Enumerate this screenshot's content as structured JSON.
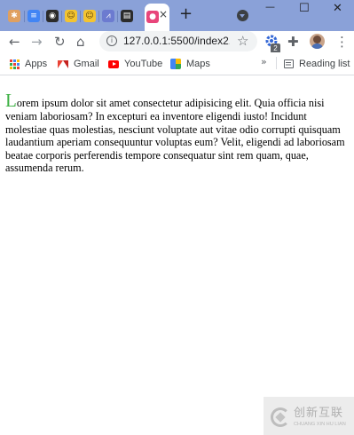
{
  "tabstrip": {
    "tabs": [
      {
        "icon": "puzzle-favicon",
        "color": "#e0a060",
        "glyph": "✱"
      },
      {
        "icon": "docs-favicon",
        "color": "#4285f4",
        "glyph": "≡"
      },
      {
        "icon": "circle-favicon",
        "color": "#2b2b2b",
        "glyph": "◉"
      },
      {
        "icon": "emoji-favicon",
        "color": "#f4c430",
        "glyph": "☺"
      },
      {
        "icon": "emoji-favicon",
        "color": "#f4c430",
        "glyph": "☺"
      },
      {
        "icon": "chart-favicon",
        "color": "#6c7bd0",
        "glyph": "⩘"
      },
      {
        "icon": "app-favicon",
        "color": "#2b2b2b",
        "glyph": "▤"
      }
    ],
    "active_tab": {
      "icon": "pink-favicon",
      "color": "#e8457a",
      "glyph": "●",
      "close_glyph": "×"
    },
    "new_tab_glyph": "+",
    "window": {
      "minimize_glyph": "—",
      "maximize_glyph": "☐",
      "close_glyph": "✕"
    }
  },
  "toolbar": {
    "back_glyph": "←",
    "forward_glyph": "→",
    "reload_glyph": "↻",
    "home_glyph": "⌂",
    "info_glyph": "i",
    "url": "127.0.0.1:5500/index2...",
    "star_glyph": "☆",
    "extension_badge": "2",
    "extensions_glyph": "✚",
    "menu_glyph": "⋮"
  },
  "bookmarks": {
    "items": [
      {
        "label": "Apps",
        "icon": "apps-grid-icon"
      },
      {
        "label": "Gmail",
        "icon": "gmail-icon"
      },
      {
        "label": "YouTube",
        "icon": "youtube-icon"
      },
      {
        "label": "Maps",
        "icon": "maps-icon"
      }
    ],
    "more_glyph": "»",
    "reading_list": "Reading list"
  },
  "page": {
    "drop_cap": "L",
    "body": "orem ipsum dolor sit amet consectetur adipisicing elit. Quia officia nisi veniam laboriosam? In excepturi ea inventore eligendi iusto! Incidunt molestiae quas molestias, nesciunt voluptate aut vitae odio corrupti quisquam laudantium aperiam consequuntur voluptas eum? Velit, eligendi ad laboriosam beatae corporis perferendis tempore consequatur sint rem quam, quae, assumenda rerum."
  },
  "watermark": {
    "cn": "创新互联",
    "en": "CHUANG XIN HU LIAN"
  },
  "colors": {
    "tabstrip": "#8aa1d8",
    "drop_cap": "#3cb043"
  }
}
